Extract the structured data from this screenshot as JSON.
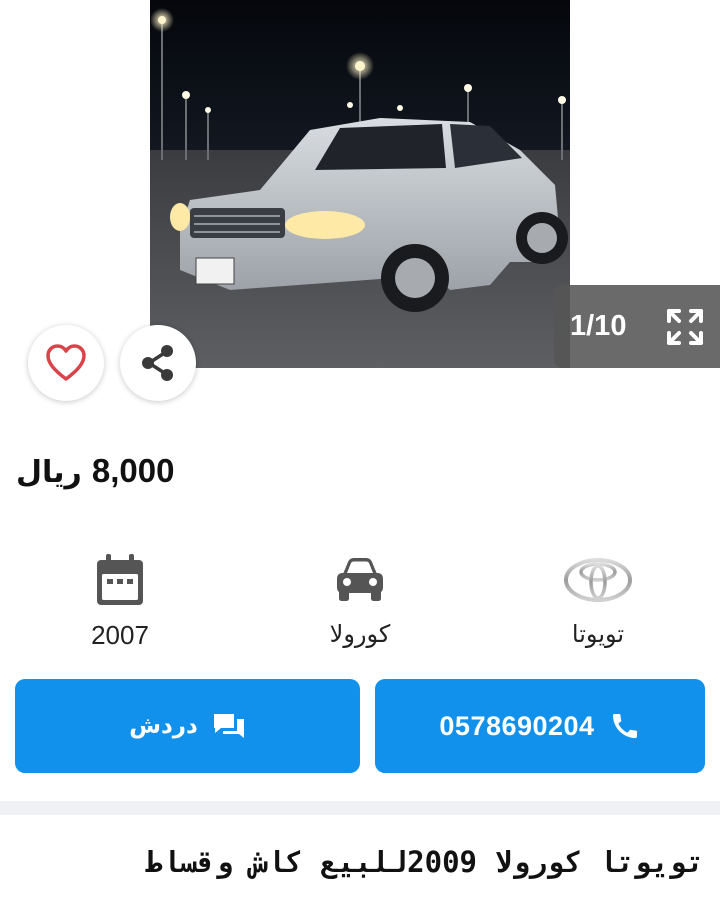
{
  "gallery": {
    "counter": "1/10",
    "prev_icon": "chevron-left-icon",
    "next_icon": "chevron-right-icon",
    "fullscreen_icon": "fullscreen-icon"
  },
  "actions": {
    "favorite_icon": "heart-icon",
    "share_icon": "share-icon"
  },
  "listing": {
    "price_amount": "8,000",
    "price_currency": "ريال",
    "title": "تويوتا كورولا 2009للبيع كاش وقساط"
  },
  "specs": {
    "year": "2007",
    "model": "كورولا",
    "brand": "تويوتا"
  },
  "buttons": {
    "chat_label": "دردش",
    "call_label": "0578690204"
  },
  "colors": {
    "primary": "#1291ec",
    "heart": "#d9434a",
    "icon_gray": "#555555",
    "separator": "#f0f1f5"
  }
}
